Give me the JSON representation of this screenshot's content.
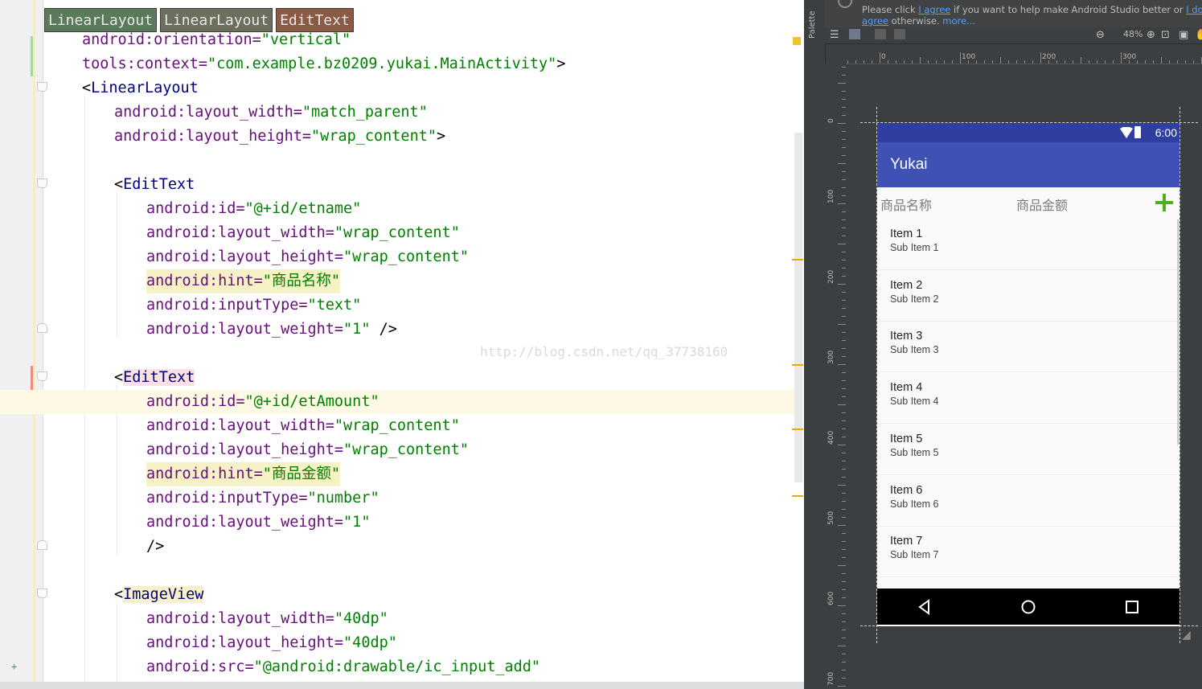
{
  "editor": {
    "breadcrumbs": [
      "LinearLayout",
      "LinearLayout",
      "EditText"
    ],
    "watermark": "http://blog.csdn.net/qq_37738160",
    "lines": [
      [
        {
          "t": "android:orientation=",
          "c": "attr"
        },
        {
          "t": "\"vertical\"",
          "c": "val"
        }
      ],
      [
        {
          "t": "tools:context=",
          "c": "attr"
        },
        {
          "t": "\"com.example.bz0209.yukai.MainActivity\"",
          "c": "val"
        },
        {
          "t": ">",
          "c": "plain"
        }
      ],
      [
        {
          "t": "<",
          "c": "plain"
        },
        {
          "t": "LinearLayout",
          "c": "tag"
        }
      ],
      [
        {
          "t": "android:layout_width=",
          "c": "attr"
        },
        {
          "t": "\"match_parent\"",
          "c": "val"
        }
      ],
      [
        {
          "t": "android:layout_height=",
          "c": "attr"
        },
        {
          "t": "\"wrap_content\"",
          "c": "val"
        },
        {
          "t": ">",
          "c": "plain"
        }
      ],
      [],
      [
        {
          "t": "<",
          "c": "plain"
        },
        {
          "t": "EditText",
          "c": "tag"
        }
      ],
      [
        {
          "t": "android:id=",
          "c": "attr"
        },
        {
          "t": "\"@+id/etname\"",
          "c": "val"
        }
      ],
      [
        {
          "t": "android:layout_width=",
          "c": "attr"
        },
        {
          "t": "\"wrap_content\"",
          "c": "val"
        }
      ],
      [
        {
          "t": "android:layout_height=",
          "c": "attr"
        },
        {
          "t": "\"wrap_content\"",
          "c": "val"
        }
      ],
      [
        {
          "t": "android:hint=",
          "c": "attr"
        },
        {
          "t": "\"商品名称\"",
          "c": "val"
        }
      ],
      [
        {
          "t": "android:inputType=",
          "c": "attr"
        },
        {
          "t": "\"text\"",
          "c": "val"
        }
      ],
      [
        {
          "t": "android:layout_weight=",
          "c": "attr"
        },
        {
          "t": "\"1\"",
          "c": "val"
        },
        {
          "t": " />",
          "c": "plain"
        }
      ],
      [],
      [
        {
          "t": "<",
          "c": "plain"
        },
        {
          "t": "EditText",
          "c": "tag"
        }
      ],
      [
        {
          "t": "android:id=",
          "c": "attr"
        },
        {
          "t": "\"@+id/etAmount\"",
          "c": "val"
        }
      ],
      [
        {
          "t": "android:layout_width=",
          "c": "attr"
        },
        {
          "t": "\"wrap_content\"",
          "c": "val"
        }
      ],
      [
        {
          "t": "android:layout_height=",
          "c": "attr"
        },
        {
          "t": "\"wrap_content\"",
          "c": "val"
        }
      ],
      [
        {
          "t": "android:hint=",
          "c": "attr"
        },
        {
          "t": "\"商品金额\"",
          "c": "val"
        }
      ],
      [
        {
          "t": "android:inputType=",
          "c": "attr"
        },
        {
          "t": "\"number\"",
          "c": "val"
        }
      ],
      [
        {
          "t": "android:layout_weight=",
          "c": "attr"
        },
        {
          "t": "\"1\"",
          "c": "val"
        }
      ],
      [
        {
          "t": "/>",
          "c": "plain"
        }
      ],
      [],
      [
        {
          "t": "<",
          "c": "plain"
        },
        {
          "t": "ImageView",
          "c": "tag"
        }
      ],
      [
        {
          "t": "android:layout_width=",
          "c": "attr"
        },
        {
          "t": "\"40dp\"",
          "c": "val"
        }
      ],
      [
        {
          "t": "android:layout_height=",
          "c": "attr"
        },
        {
          "t": "\"40dp\"",
          "c": "val"
        }
      ],
      [
        {
          "t": "android:src=",
          "c": "attr"
        },
        {
          "t": "\"@android:drawable/ic_input_add\"",
          "c": "val"
        }
      ]
    ]
  },
  "designer": {
    "palette_label": "Palette",
    "notice": {
      "line2_before": "Please click ",
      "line2_link": "I agree",
      "line2_after": " if you want to help make Android Studio better or ",
      "line2_link2": "I don't",
      "line3_link": "agree",
      "line3_after": " otherwise. ",
      "line3_more": "more..."
    },
    "zoom": "48%",
    "ruler_top": [
      "0",
      "100",
      "200",
      "300"
    ],
    "ruler_left": [
      "0",
      "100",
      "200",
      "300",
      "400",
      "500",
      "600",
      "700"
    ]
  },
  "device": {
    "time": "6:00",
    "app_title": "Yukai",
    "hint_name": "商品名称",
    "hint_amount": "商品金额",
    "items": [
      {
        "title": "Item 1",
        "sub": "Sub Item 1"
      },
      {
        "title": "Item 2",
        "sub": "Sub Item 2"
      },
      {
        "title": "Item 3",
        "sub": "Sub Item 3"
      },
      {
        "title": "Item 4",
        "sub": "Sub Item 4"
      },
      {
        "title": "Item 5",
        "sub": "Sub Item 5"
      },
      {
        "title": "Item 6",
        "sub": "Sub Item 6"
      },
      {
        "title": "Item 7",
        "sub": "Sub Item 7"
      }
    ]
  },
  "colors": {
    "attr": "#660e7a",
    "value": "#008000",
    "tag": "#000080",
    "app_bar": "#3f51b5",
    "status_bar": "#303f9f",
    "add_icon": "#4caf1e"
  }
}
